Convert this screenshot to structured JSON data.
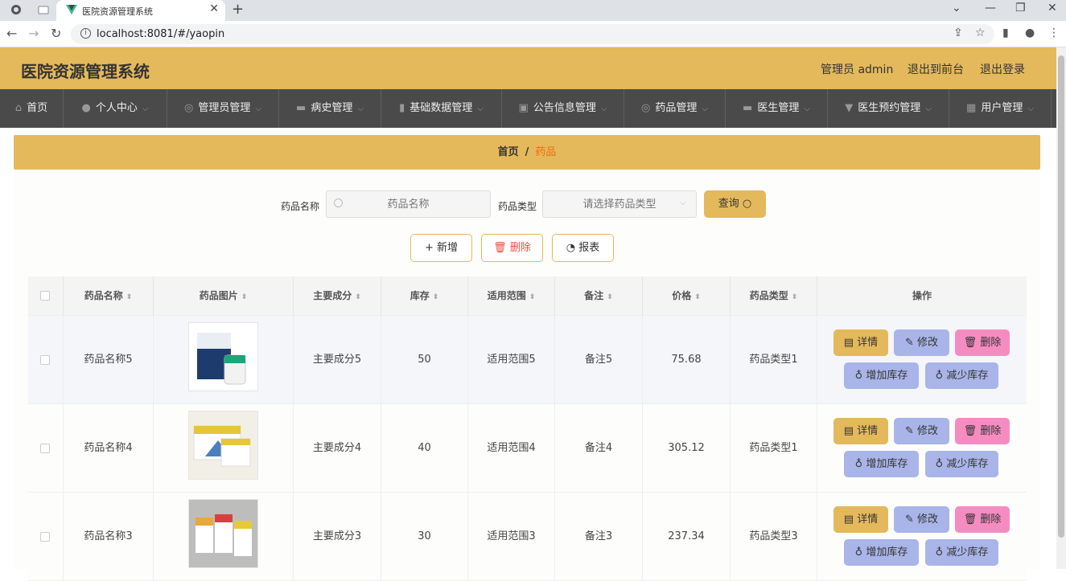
{
  "browser": {
    "tab_title": "医院资源管理系统",
    "url": "localhost:8081/#/yaopin"
  },
  "header": {
    "title": "医院资源管理系统",
    "user": "管理员 admin",
    "to_front": "退出到前台",
    "logout": "退出登录"
  },
  "nav": [
    {
      "label": "首页",
      "icon": "home-icon"
    },
    {
      "label": "个人中心",
      "icon": "user-icon"
    },
    {
      "label": "管理员管理",
      "icon": "admin-icon"
    },
    {
      "label": "病史管理",
      "icon": "chat-icon"
    },
    {
      "label": "基础数据管理",
      "icon": "chart-icon"
    },
    {
      "label": "公告信息管理",
      "icon": "clipboard-icon"
    },
    {
      "label": "药品管理",
      "icon": "circle-icon"
    },
    {
      "label": "医生管理",
      "icon": "monitor-icon"
    },
    {
      "label": "医生预约管理",
      "icon": "pin-icon"
    },
    {
      "label": "用户管理",
      "icon": "grid-icon"
    }
  ],
  "breadcrumb": {
    "home": "首页",
    "sep": "/",
    "current": "药品"
  },
  "search": {
    "name_label": "药品名称",
    "name_placeholder": "药品名称",
    "type_label": "药品类型",
    "type_placeholder": "请选择药品类型",
    "query": "查询"
  },
  "ops": {
    "add": "+ 新增",
    "delete": "删除",
    "report": "报表"
  },
  "table": {
    "headers": [
      "药品名称",
      "药品图片",
      "主要成分",
      "库存",
      "适用范围",
      "备注",
      "价格",
      "药品类型",
      "操作"
    ],
    "rows": [
      {
        "name": "药品名称5",
        "component": "主要成分5",
        "stock": "50",
        "scope": "适用范围5",
        "note": "备注5",
        "price": "75.68",
        "type": "药品类型1"
      },
      {
        "name": "药品名称4",
        "component": "主要成分4",
        "stock": "40",
        "scope": "适用范围4",
        "note": "备注4",
        "price": "305.12",
        "type": "药品类型1"
      },
      {
        "name": "药品名称3",
        "component": "主要成分3",
        "stock": "30",
        "scope": "适用范围3",
        "note": "备注3",
        "price": "237.34",
        "type": "药品类型3"
      }
    ],
    "actions": {
      "detail": "详情",
      "edit": "修改",
      "delete": "删除",
      "add_stock": "增加库存",
      "reduce_stock": "减少库存"
    }
  },
  "colors": {
    "accent": "#e4b95b",
    "nav": "#4a4a4a",
    "edit": "#a9b5e8",
    "delete": "#f58cc1",
    "breadcrumb_current": "#ec6b16"
  }
}
